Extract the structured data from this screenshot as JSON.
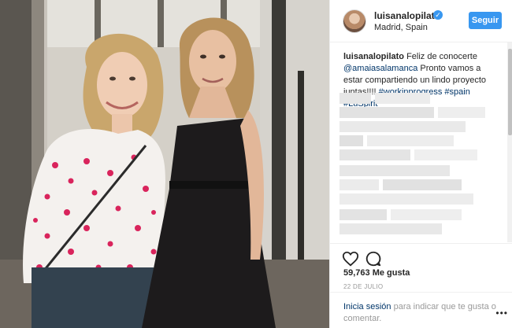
{
  "post": {
    "username": "luisanalopilato",
    "verified_glyph": "✓",
    "location": "Madrid, Spain",
    "follow_label": "Seguir",
    "caption": {
      "username": "luisanalopilato",
      "text_1": "Feliz de conocerte",
      "mention": "@amaiasalamanca",
      "text_2": "Pronto vamos a estar compartiendo un lindo proyecto juntas!!!!",
      "hashtags": "#workinprogress #spain #LuSpirit"
    },
    "likes": "59,763 Me gusta",
    "date": "22 DE JULIO",
    "login": {
      "link": "Inicia sesión",
      "text": "para indicar que te gusta o comentar."
    },
    "more_glyph": "•••"
  },
  "icons": {
    "heart": "heart-icon",
    "comment": "comment-icon",
    "more": "more-options-icon",
    "verified": "verified-badge-icon"
  },
  "colors": {
    "accent_blue": "#3897f0",
    "link_blue": "#003569",
    "muted_gray": "#999999"
  }
}
